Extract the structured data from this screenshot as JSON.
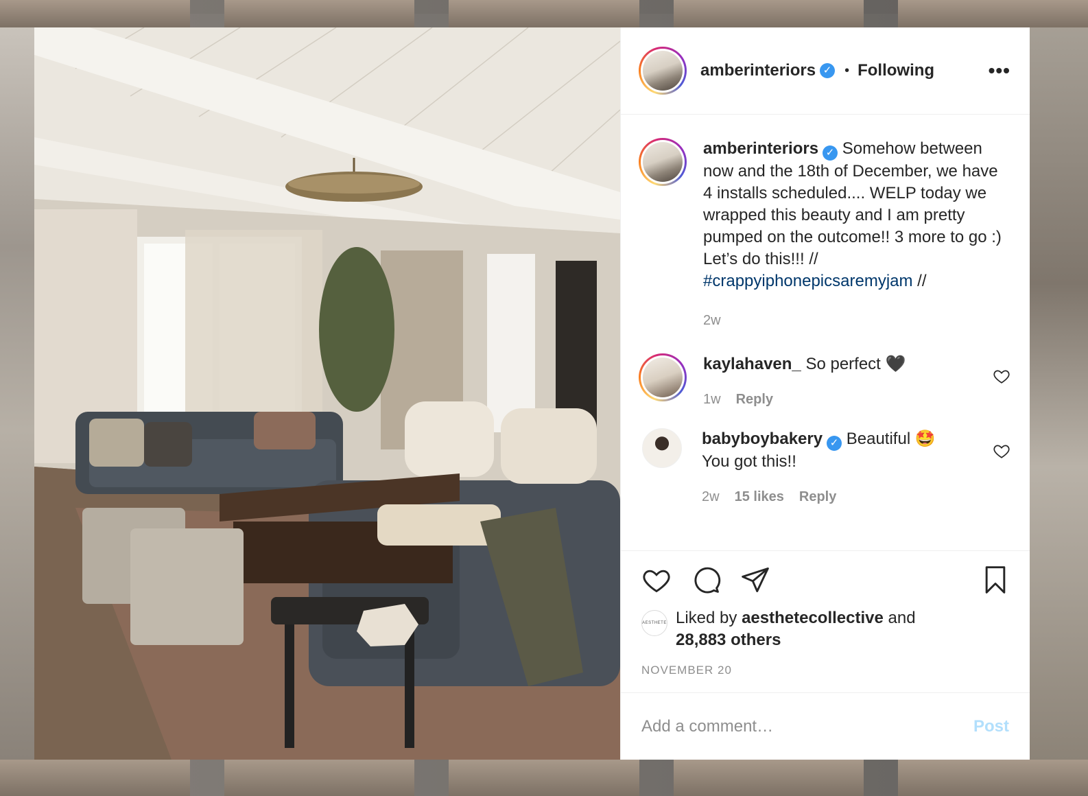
{
  "post": {
    "username": "amberinteriors",
    "verified_icon": "verified-badge-icon",
    "follow_state": "Following",
    "separator": "•",
    "more_label": "•••"
  },
  "caption": {
    "username": "amberinteriors",
    "text": "Somehow between now and the 18th of December, we have 4 installs scheduled.... WELP today we wrapped this beauty and I am pretty pumped on the outcome!! 3 more to go :) Let’s do this!!! //",
    "hashtag": "#crappyiphonepicsaremyjam",
    "suffix": " //",
    "time": "2w"
  },
  "comments": [
    {
      "username": "kaylahaven_",
      "text": "So perfect 🖤",
      "time": "1w",
      "reply": "Reply"
    },
    {
      "username": "babyboybakery",
      "text": "Beautiful 🤩",
      "text2": "You got this!!",
      "time": "2w",
      "likes": "15 likes",
      "reply": "Reply"
    }
  ],
  "likes": {
    "prefix": "Liked by ",
    "user": "aesthetecollective",
    "and": " and",
    "others": "28,883 others",
    "avatar_text": "AESTHETE"
  },
  "date": "NOVEMBER 20",
  "add_comment": {
    "placeholder": "Add a comment…",
    "post_label": "Post"
  },
  "colors": {
    "hashtag": "#00376b",
    "verified": "#3897f0",
    "post_disabled": "#b2dffc",
    "meta": "#8e8e8e"
  }
}
